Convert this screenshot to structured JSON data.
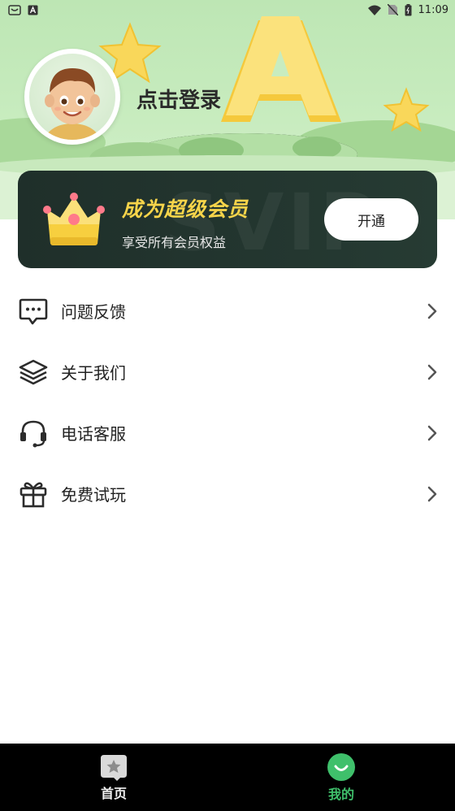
{
  "status_bar": {
    "time": "11:09",
    "left_icons": [
      "android-notification-icon",
      "a-letter-icon"
    ],
    "right_icons": [
      "wifi-icon",
      "no-sim-icon",
      "battery-icon"
    ]
  },
  "header": {
    "login_text": "点击登录",
    "decorations": [
      "letter-a-icon",
      "star-icon"
    ]
  },
  "vip": {
    "watermark": "SVIP",
    "title": "成为超级会员",
    "subtitle": "享受所有会员权益",
    "button_label": "开通",
    "title_color": "#f7d44a"
  },
  "menu": {
    "items": [
      {
        "label": "问题反馈",
        "icon": "chat-bubble-icon"
      },
      {
        "label": "关于我们",
        "icon": "layers-icon"
      },
      {
        "label": "电话客服",
        "icon": "headset-icon"
      },
      {
        "label": "免费试玩",
        "icon": "gift-icon"
      }
    ]
  },
  "bottom_nav": {
    "items": [
      {
        "label": "首页",
        "icon": "home-star-icon",
        "active": false
      },
      {
        "label": "我的",
        "icon": "smile-icon",
        "active": true
      }
    ],
    "active_color": "#3fc06b"
  }
}
